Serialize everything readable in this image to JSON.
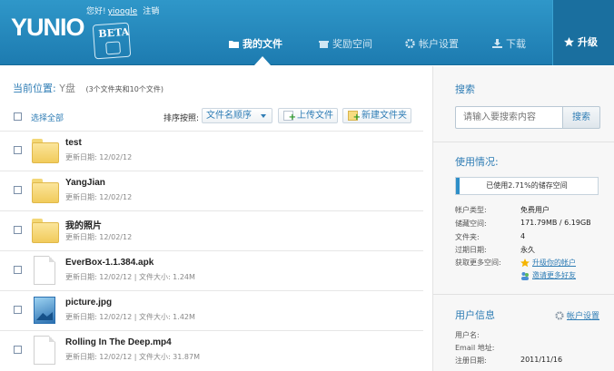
{
  "header": {
    "logo": "YUNIO",
    "beta": "BETA",
    "greeting": "您好!",
    "username": "yioogle",
    "logout": "注销",
    "nav": [
      {
        "label": "我的文件",
        "icon": "folder-icon"
      },
      {
        "label": "奖励空间",
        "icon": "gift-icon"
      },
      {
        "label": "帐户设置",
        "icon": "gear-icon"
      },
      {
        "label": "下载",
        "icon": "download-icon"
      }
    ],
    "upgrade": "升级"
  },
  "main": {
    "location_label": "当前位置:",
    "drive": "Y盘",
    "count": "(3个文件夹和10个文件)",
    "select_all": "选择全部",
    "sort_label": "排序按照:",
    "sort_value": "文件名顺序",
    "upload": "上传文件",
    "new_folder": "新建文件夹",
    "files": [
      {
        "type": "folder",
        "name": "test",
        "meta": "更新日期: 12/02/12"
      },
      {
        "type": "folder",
        "name": "YangJian",
        "meta": "更新日期: 12/02/12"
      },
      {
        "type": "folder",
        "name": "我的照片",
        "meta": "更新日期: 12/02/12"
      },
      {
        "type": "doc",
        "name": "EverBox-1.1.384.apk",
        "meta": "更新日期: 12/02/12 | 文件大小: 1.24M"
      },
      {
        "type": "img",
        "name": "picture.jpg",
        "meta": "更新日期: 12/02/12 | 文件大小: 1.42M"
      },
      {
        "type": "doc",
        "name": "Rolling In The Deep.mp4",
        "meta": "更新日期: 12/02/12 | 文件大小: 31.87M"
      }
    ]
  },
  "sidebar": {
    "search_title": "搜索",
    "search_placeholder": "请输入要搜索内容",
    "search_button": "搜索",
    "usage_title": "使用情况:",
    "usage_text": "已使用2.71%的储存空间",
    "usage_percent": 2.71,
    "account_type_label": "帐户类型:",
    "account_type": "免费用户",
    "storage_label": "储藏空间:",
    "storage": "171.79MB / 6.19GB",
    "folders_label": "文件夹:",
    "folders": "4",
    "expire_label": "过期日期:",
    "expire": "永久",
    "more_label": "获取更多空间:",
    "upgrade_link": "升级你的帐户",
    "invite_link": "邀请更多好友",
    "user_title": "用户信息",
    "settings_link": "帐户设置",
    "username_label": "用户名:",
    "email_label": "Email 地址:",
    "reg_label": "注册日期:",
    "reg_date": "2011/11/16"
  }
}
